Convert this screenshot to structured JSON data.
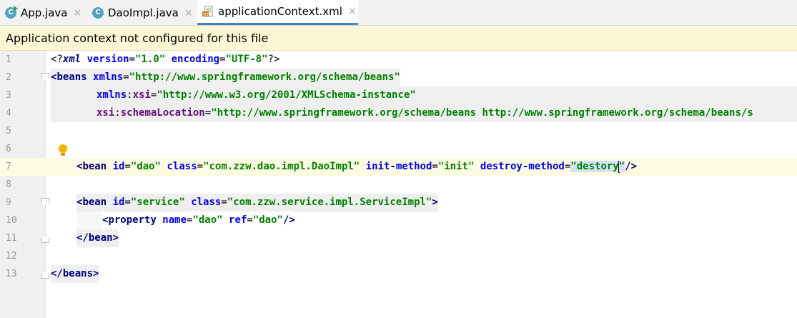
{
  "tabs": [
    {
      "label": "App.java",
      "icon": "java-class-icon",
      "active": false
    },
    {
      "label": "DaoImpl.java",
      "icon": "java-class-icon",
      "active": false
    },
    {
      "label": "applicationContext.xml",
      "icon": "xml-file-icon",
      "active": true
    }
  ],
  "tab_close_glyph": "×",
  "class_icon_letter": "C",
  "banner": {
    "text": "Application context not configured for this file"
  },
  "editor": {
    "line_numbers": [
      "1",
      "2",
      "3",
      "4",
      "5",
      "6",
      "7",
      "8",
      "9",
      "10",
      "11",
      "12",
      "13"
    ],
    "current_line": "7",
    "lines": {
      "l1": [
        "<?",
        "xml ",
        "version",
        "=",
        "\"1.0\"",
        " ",
        "encoding",
        "=",
        "\"UTF-8\"",
        "?>"
      ],
      "l2": [
        "<",
        "beans ",
        "xmlns",
        "=",
        "\"http://www.springframework.org/schema/beans\""
      ],
      "l3": [
        "xmlns",
        ":",
        "xsi",
        "=",
        "\"http://www.w3.org/2001/XMLSchema-instance\""
      ],
      "l4": [
        "xsi",
        ":",
        "schemaLocation",
        "=",
        "\"http://www.springframework.org/schema/beans http://www.springframework.org/schema/beans/s"
      ],
      "l7": [
        "<",
        "bean ",
        "id",
        "=",
        "\"dao\"",
        " ",
        "class",
        "=",
        "\"com.zzw.dao.impl.DaoImpl\"",
        " ",
        "init-method",
        "=",
        "\"init\"",
        " ",
        "destroy-method",
        "=",
        "\"",
        "destory",
        "\"",
        "/>"
      ],
      "l9": [
        "<",
        "bean ",
        "id",
        "=",
        "\"service\"",
        " ",
        "class",
        "=",
        "\"com.zzw.service.impl.ServiceImpl\"",
        ">"
      ],
      "l10": [
        "<",
        "property ",
        "name",
        "=",
        "\"dao\"",
        " ",
        "ref",
        "=",
        "\"dao\"",
        "/>"
      ],
      "l11": [
        "</",
        "bean",
        ">"
      ],
      "l13": [
        "</",
        "beans",
        ">"
      ]
    }
  },
  "colors": {
    "tag": "#000080",
    "attribute": "#0000ff",
    "namespace": "#660e7a",
    "string": "#008000",
    "banner_bg": "#fcf8d5",
    "active_tab_underline": "#4083c9"
  }
}
